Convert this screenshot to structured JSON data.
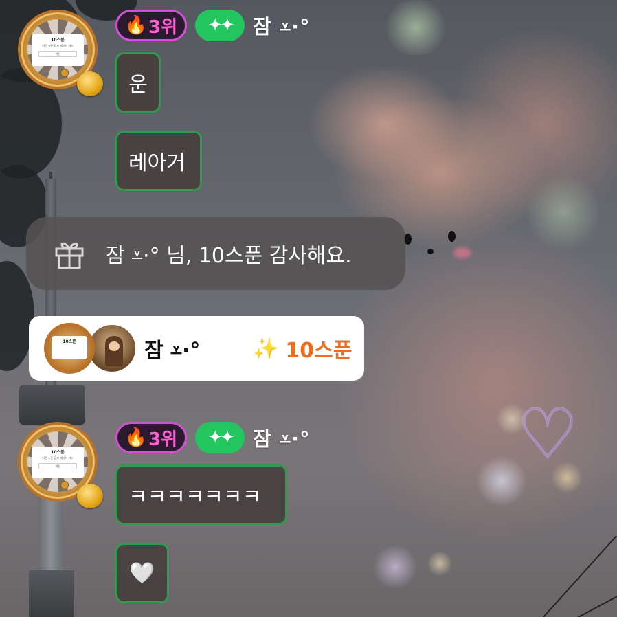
{
  "messages": [
    {
      "rank": "3위",
      "username": "잠 ⩡·°",
      "bubbles": [
        "운",
        "레아거"
      ]
    },
    {
      "rank": "3위",
      "username": "잠 ⩡·°",
      "bubbles": [
        "ㅋㅋㅋㅋㅋㅋㅋ",
        "🤍"
      ]
    }
  ],
  "avatar_card": {
    "title": "10스푼",
    "text": "이건 스푼 감사 메시지 카드",
    "button": "확인"
  },
  "gift_banner": {
    "text": "잠 ⩡·°  님, 10스푼 감사해요.",
    "icon": "gift-icon"
  },
  "spoon_card": {
    "username": "잠 ⩡·°",
    "amount": "10스푼",
    "icon": "sparkler-icon",
    "mini_title": "10스푼"
  },
  "badges": {
    "rank_icon": "fire-icon",
    "sparkle_icon": "sparkles-icon",
    "sparkle_glyph": "✦✦"
  },
  "colors": {
    "bubble_border": "#2f9b4d",
    "rank_border": "#d24fd8",
    "rank_text": "#ff5fd2",
    "sparkle_badge": "#22c55e",
    "spoon_amount": "#f26a1b"
  }
}
